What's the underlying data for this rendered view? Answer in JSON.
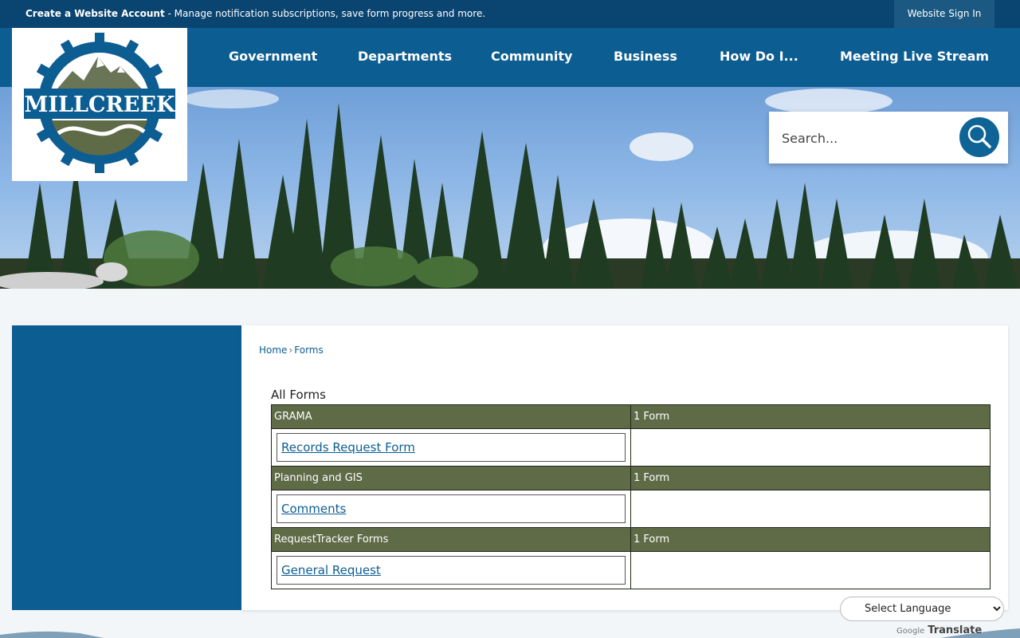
{
  "topbar": {
    "create_account_bold": "Create a Website Account",
    "create_account_rest": " - Manage notification subscriptions, save form progress and more.",
    "sign_in": "Website Sign In"
  },
  "logo": {
    "name": "MILLCREEK"
  },
  "nav": [
    "Government",
    "Departments",
    "Community",
    "Business",
    "How Do I...",
    "Meeting Live Stream"
  ],
  "search": {
    "placeholder": "Search..."
  },
  "breadcrumb": {
    "home": "Home",
    "separator": "›",
    "current": "Forms"
  },
  "forms": {
    "heading": "All Forms",
    "categories": [
      {
        "name": "GRAMA",
        "count": "1 Form",
        "items": [
          "Records Request Form"
        ]
      },
      {
        "name": "Planning and GIS",
        "count": "1 Form",
        "items": [
          "Comments"
        ]
      },
      {
        "name": "RequestTracker Forms",
        "count": "1 Form",
        "items": [
          "General Request"
        ]
      }
    ]
  },
  "translate": {
    "select_label": "Select Language",
    "google": "Google",
    "translate": "Translate"
  },
  "colors": {
    "topbar": "#0a4470",
    "nav": "#0c5d92",
    "category_row": "#5f6a47",
    "link": "#0c5d92"
  }
}
